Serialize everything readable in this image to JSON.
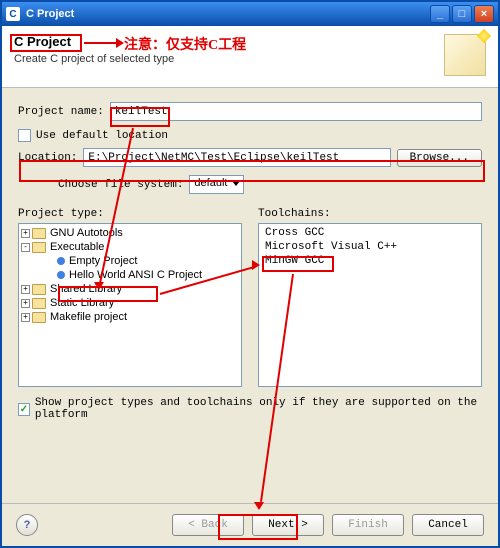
{
  "titlebar": {
    "title": "C Project"
  },
  "header": {
    "title": "C Project",
    "subtitle": "Create C project of selected type"
  },
  "annotation_text": "注意：仅支持C工程",
  "form": {
    "project_name_label": "Project name:",
    "project_name_value": "keilTest",
    "use_default_label": "Use default location",
    "location_label": "Location:",
    "location_value": "E:\\Project\\NetMC\\Test\\Eclipse\\keilTest",
    "browse_label": "Browse...",
    "file_system_label": "Choose file system:",
    "file_system_value": "default"
  },
  "tree": {
    "label": "Project type:",
    "gnu": "GNU Autotools",
    "exe": "Executable",
    "empty": "Empty Project",
    "hello": "Hello World ANSI C Project",
    "shared": "Shared Library",
    "static": "Static Library",
    "makefile": "Makefile project"
  },
  "toolchains": {
    "label": "Toolchains:",
    "t1": "Cross GCC",
    "t2": "Microsoft Visual C++",
    "t3": "MinGW GCC"
  },
  "show_only_label": "Show project types and toolchains only if they are supported on the platform",
  "buttons": {
    "back": "< Back",
    "next": "Next >",
    "finish": "Finish",
    "cancel": "Cancel"
  }
}
